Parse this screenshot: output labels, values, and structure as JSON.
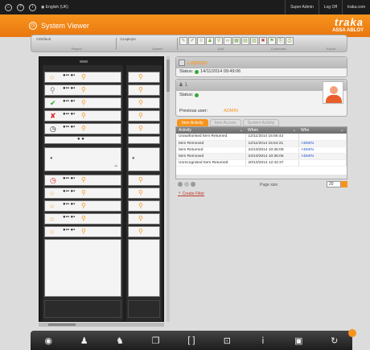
{
  "topbar": {
    "icons": [
      "home-icon",
      "help-icon",
      "info-icon"
    ],
    "language": "English (UK)",
    "links": [
      "Super Admin",
      "Log Off",
      "traka.com"
    ]
  },
  "header": {
    "title": "System Viewer",
    "brand": "traka",
    "brand_sub": "ASSA ABLOY"
  },
  "toolbar": {
    "region_value": "Default",
    "region_caption": "Region",
    "system_value": "Laptops",
    "system_caption": "System",
    "edit_caption": "Edit",
    "customise_caption": "Customise",
    "export_caption": "Export"
  },
  "item": {
    "name": "Laptops",
    "status_label": "Status:",
    "status_time": "14/11/2014 09:49:06"
  },
  "user": {
    "number": "1",
    "status_label": "Status:",
    "previous_user_label": "Previous user:",
    "previous_user": "ADMIN"
  },
  "tabs": [
    "Item Activity",
    "Item Access",
    "System Activity"
  ],
  "activity_table": {
    "columns": [
      "Activity",
      "When",
      "Who"
    ],
    "rows": [
      [
        "Unauthorised Item Returned",
        "12/11/2014 15:56:43",
        ""
      ],
      [
        "Item Removed",
        "12/11/2014 15:54:21",
        "ADMIN"
      ],
      [
        "Item Returned",
        "24/10/2014 10:36:08",
        "ADMIN"
      ],
      [
        "Item Removed",
        "24/10/2014 10:36:06",
        "ADMIN"
      ],
      [
        "Unrecognised Item Returned",
        "20/10/2014 12:42:37",
        ""
      ]
    ]
  },
  "pager": {
    "page_size_label": "Page size:",
    "page_size": "20"
  },
  "filter_link": "Create Filter",
  "bottom_icons": [
    "eye-icon",
    "user-icon",
    "users-icon",
    "copy-icon",
    "frame-icon",
    "target-icon",
    "info-icon",
    "panel-icon",
    "refresh-icon"
  ]
}
